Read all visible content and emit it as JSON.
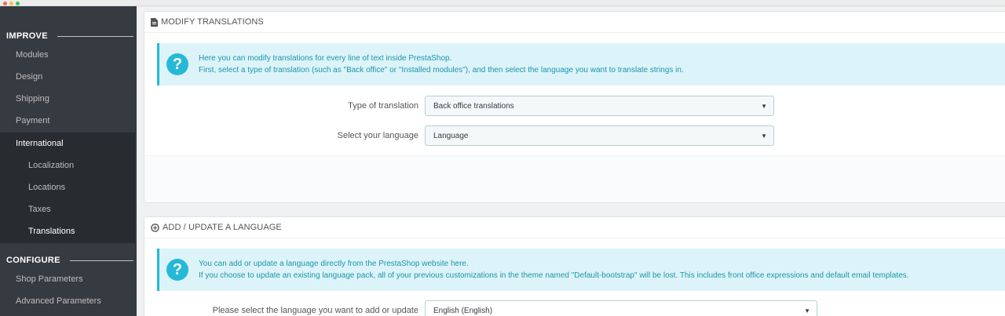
{
  "sidebar": {
    "improve_label": "IMPROVE",
    "configure_label": "CONFIGURE",
    "items": [
      {
        "label": "Modules"
      },
      {
        "label": "Design"
      },
      {
        "label": "Shipping"
      },
      {
        "label": "Payment"
      },
      {
        "label": "International"
      }
    ],
    "subitems": [
      {
        "label": "Localization"
      },
      {
        "label": "Locations"
      },
      {
        "label": "Taxes"
      },
      {
        "label": "Translations"
      }
    ],
    "configure_items": [
      {
        "label": "Shop Parameters"
      },
      {
        "label": "Advanced Parameters"
      }
    ]
  },
  "modify_panel": {
    "heading": "MODIFY TRANSLATIONS",
    "icon": "document-icon",
    "alert_line1": "Here you can modify translations for every line of text inside PrestaShop.",
    "alert_line2": "First, select a type of translation (such as \"Back office\" or \"Installed modules\"), and then select the language you want to translate strings in.",
    "type_label": "Type of translation",
    "type_value": "Back office translations",
    "language_label": "Select your language",
    "language_value": "Language"
  },
  "add_panel": {
    "heading": "ADD / UPDATE A LANGUAGE",
    "icon": "plus-circle-icon",
    "alert_line1": "You can add or update a language directly from the PrestaShop website here.",
    "alert_line2": "If you choose to update an existing language pack, all of your previous customizations in the theme named \"Default-bootstrap\" will be lost. This includes front office expressions and default email templates.",
    "select_label": "Please select the language you want to add or update",
    "select_value": "English (English)"
  },
  "colors": {
    "sidebar_bg": "#363a41",
    "sidebar_active_bg": "#282b30",
    "alert_bg": "#dcf4f9",
    "alert_accent": "#25b9d7"
  }
}
